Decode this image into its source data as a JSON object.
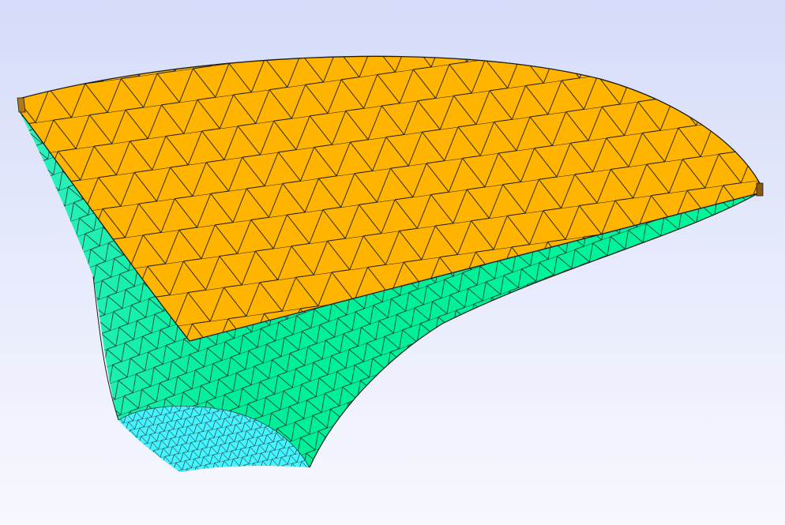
{
  "viewport": {
    "background_top": "#d5dcf9",
    "background_bottom": "#f7f8fe"
  },
  "mesh": {
    "element_type": "triangle",
    "top_face_color": "#ffb400",
    "side_face_color": "#00f59a",
    "inner_face_color": "#44f4ff",
    "edge_color": "#1a1a1a"
  }
}
